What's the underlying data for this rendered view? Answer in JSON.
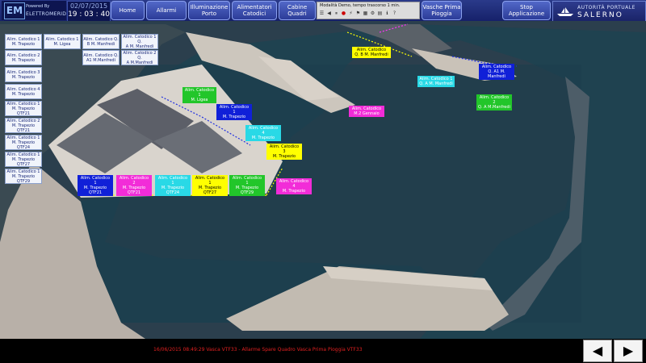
{
  "header": {
    "logo": {
      "mark": "EM",
      "tagline": "Powered By",
      "name": "ELETTROMERID"
    },
    "date": "02/07/2015",
    "time": "19 : 03 : 40",
    "nav": [
      {
        "id": "home",
        "label": "Home"
      },
      {
        "id": "allarmi",
        "label": "Allarmi"
      },
      {
        "id": "illuminazione",
        "label": "Illuminazione\nPorto"
      },
      {
        "id": "alimentatori",
        "label": "Alimentatori\nCatodici"
      },
      {
        "id": "cabine",
        "label": "Cabine Quadri"
      },
      {
        "id": "vasche",
        "label": "Vasche Prima\nPioggia"
      },
      {
        "id": "stop",
        "label": "Stop Applicazione"
      }
    ],
    "demo_text": "Modalità Demo, tempo trascorso 1 min.",
    "demo_icons": [
      "menu-icon",
      "prev-icon",
      "pause-icon",
      "stop-icon",
      "bolt-icon",
      "flag-icon",
      "map-icon",
      "gear-icon",
      "grid-icon",
      "info-icon",
      "help-icon"
    ],
    "authority": {
      "line1": "AUTORITÀ PORTUALE",
      "line2": "SALERNO"
    }
  },
  "left_buttons": [
    "Alim. Catodico 1\nM. Trapezio",
    "Alim. Catodico 1\nM. Ligea",
    "Alim. Catodico Q.\nB M. Manfredi",
    "Alim. Catodico 1 Q.\nA M. Manfredi",
    "Alim. Catodico 2\nM. Trapezio",
    "Alim. Catodico Q.\nA1 M.Manfredi",
    "Alim. Catodico 2 Q.\nA M.Manfredi",
    "Alim. Catodico 3\nM. Trapezio",
    "Alim. Catodico 4\nM. Trapezio",
    "Alim. Catodico 1\nM. Trapezio QTF21",
    "Alim. Catodico 2\nM. Trapezio QTF21",
    "Alim. Catodico 1\nM. Trapezio QTF24",
    "Alim. Catodico 1\nM. Trapezio QTF27",
    "Alim. Catodico 1\nM. Trapezio QTF29"
  ],
  "map_labels": [
    {
      "text": "Alim. Catodico 1\nM. Ligea",
      "color": "green"
    },
    {
      "text": "Alim. Catodico 1\nM. Trapezio",
      "color": "blue"
    },
    {
      "text": "Alim. Catodico 4\nM. Trapezio",
      "color": "cyan"
    },
    {
      "text": "Alim. Catodico 3\nM. Trapezio",
      "color": "yellow"
    },
    {
      "text": "Alim. Catodico 4\nM. Trapezio",
      "color": "magenta"
    },
    {
      "text": "Alim. Catodico\nM.2 Gennaio",
      "color": "magenta"
    },
    {
      "text": "Alim. Catodico\nQ. B M. Manfredi",
      "color": "yellow"
    },
    {
      "text": "Alim. Catodico 1\nQ. A M. Manfredi",
      "color": "cyan"
    },
    {
      "text": "Alim. Catodico\nQ. A1 M.\nManfredi",
      "color": "blue"
    },
    {
      "text": "Alim. Catodico 2\nQ. A M.Manfredi",
      "color": "green"
    },
    {
      "text": "Alim. Catodico 1\nM. Trapezio\nQTF21",
      "color": "blue"
    },
    {
      "text": "Alim. Catodico 2\nM. Trapezio\nQTF21",
      "color": "magenta"
    },
    {
      "text": "Alim. Catodico 1\nM. Trapezio\nQTF24",
      "color": "cyan"
    },
    {
      "text": "Alim. Catodico 1\nM. Trapezio\nQTF27",
      "color": "yellow"
    },
    {
      "text": "Alim. Catodico 1\nM. Trapezio\nQTF29",
      "color": "green"
    }
  ],
  "footer": {
    "alarm": "16/06/2015 08:49:29 Vasca VTF33 - Allarme Spare  Quadro Vasca Prima Pioggia VTF33",
    "prev": "◀",
    "next": "▶"
  },
  "colors": {
    "accent": "#2c3c98",
    "alarm": "#e02020",
    "sea": "#1c3a4a"
  }
}
